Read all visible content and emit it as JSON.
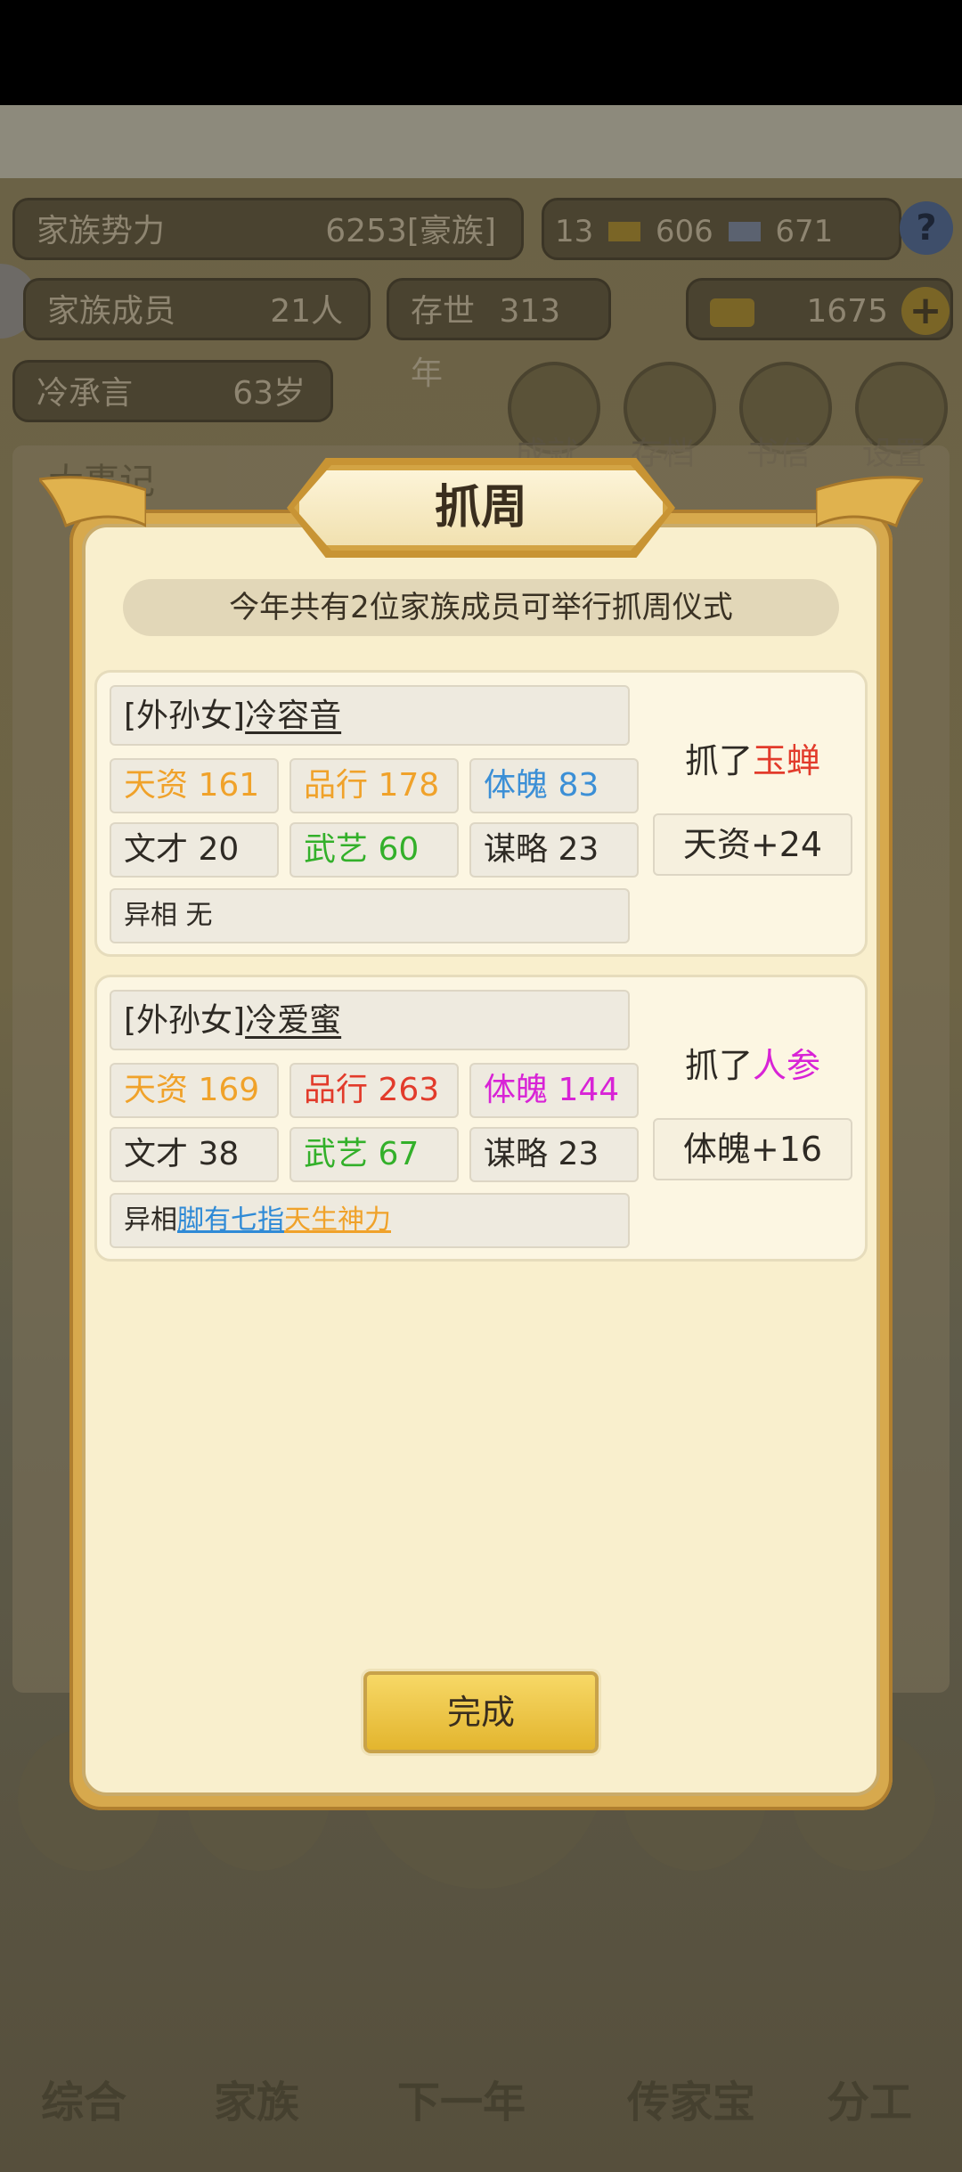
{
  "background": {
    "family_power_label": "家族势力",
    "family_power_value": "6253",
    "family_power_rank": "[豪族]",
    "res_gold": "13",
    "res_silver": "606",
    "res_coin": "671",
    "help_label": "?",
    "members_label": "家族成员",
    "members_value": "21人",
    "years_label": "存世",
    "years_value": "313年",
    "ingot_value": "1675",
    "plus_label": "+",
    "leader_name": "冷承言",
    "leader_age": "63岁",
    "menu": [
      "成就",
      "存档",
      "书信",
      "设置"
    ],
    "events_title": "大事记",
    "nav": [
      "综合",
      "家族",
      "下一年",
      "传家宝",
      "分工"
    ]
  },
  "dialog": {
    "title": "抓周",
    "subtitle": "今年共有2位家族成员可举行抓周仪式",
    "members": [
      {
        "relation": "[外孙女]",
        "name": "冷容音",
        "stats": [
          {
            "label": "天资",
            "value": "161",
            "color": "orange"
          },
          {
            "label": "品行",
            "value": "178",
            "color": "orange"
          },
          {
            "label": "体魄",
            "value": "83",
            "color": "blue"
          },
          {
            "label": "文才",
            "value": "20",
            "color": "default"
          },
          {
            "label": "武艺",
            "value": "60",
            "color": "green"
          },
          {
            "label": "谋略",
            "value": "23",
            "color": "default"
          }
        ],
        "traits_label": "异相",
        "traits": [
          "无"
        ],
        "grab_prefix": "抓了",
        "grab_item": "玉蝉",
        "grab_color": "#e23b2b",
        "bonus": "天资+24"
      },
      {
        "relation": "[外孙女]",
        "name": "冷爱蜜",
        "stats": [
          {
            "label": "天资",
            "value": "169",
            "color": "orange"
          },
          {
            "label": "品行",
            "value": "263",
            "color": "red"
          },
          {
            "label": "体魄",
            "value": "144",
            "color": "magenta"
          },
          {
            "label": "文才",
            "value": "38",
            "color": "default"
          },
          {
            "label": "武艺",
            "value": "67",
            "color": "green"
          },
          {
            "label": "谋略",
            "value": "23",
            "color": "default"
          }
        ],
        "traits_label": "异相",
        "traits": [
          "脚有七指",
          "天生神力"
        ],
        "grab_prefix": "抓了",
        "grab_item": "人参",
        "grab_color": "#d823d6",
        "bonus": "体魄+16"
      }
    ],
    "done_label": "完成"
  }
}
